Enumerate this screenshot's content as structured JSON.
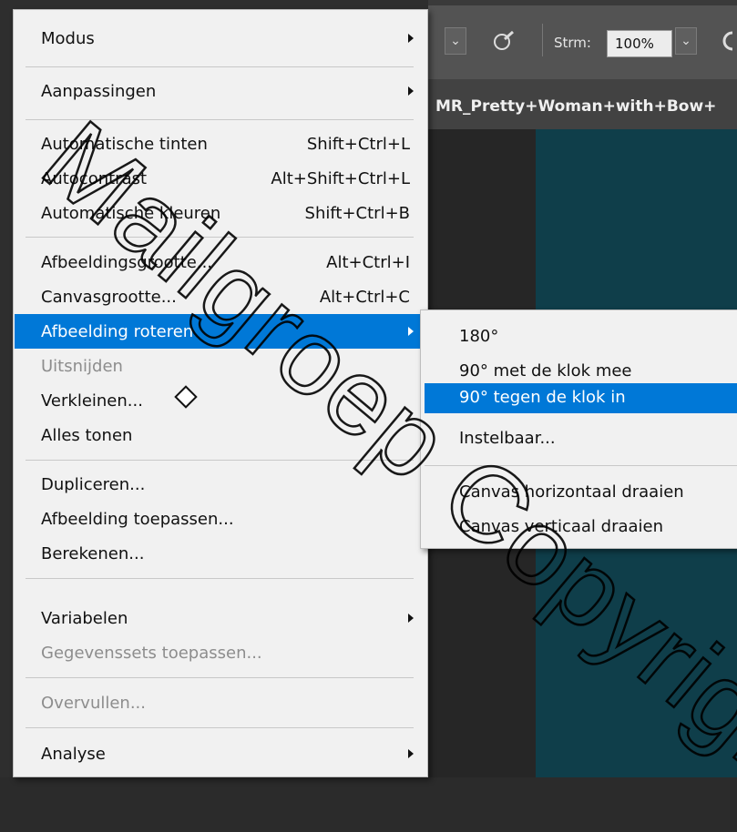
{
  "toolbar": {
    "dropdown_glyph": "⌄",
    "airbrush_icon": "airbrush-icon",
    "flow_label": "Strm:",
    "flow_value": "100%",
    "pressure_icon": "pressure-icon"
  },
  "document": {
    "tab_title": "MR_Pretty+Woman+with+Bow+"
  },
  "menu": {
    "items": [
      {
        "label": "Modus",
        "submenu": true
      },
      {
        "label": "Aanpassingen",
        "submenu": true
      },
      {
        "label": "Automatische tinten",
        "shortcut": "Shift+Ctrl+L"
      },
      {
        "label": "Autocontrast",
        "shortcut": "Alt+Shift+Ctrl+L"
      },
      {
        "label": "Automatische kleuren",
        "shortcut": "Shift+Ctrl+B"
      },
      {
        "label": "Afbeeldingsgrootte...",
        "shortcut": "Alt+Ctrl+I"
      },
      {
        "label": "Canvasgrootte...",
        "shortcut": "Alt+Ctrl+C"
      },
      {
        "label": "Afbeelding roteren",
        "submenu": true,
        "highlighted": true
      },
      {
        "label": "Uitsnijden",
        "disabled": true
      },
      {
        "label": "Verkleinen..."
      },
      {
        "label": "Alles tonen"
      },
      {
        "label": "Dupliceren..."
      },
      {
        "label": "Afbeelding toepassen..."
      },
      {
        "label": "Berekenen..."
      },
      {
        "label": "Variabelen",
        "submenu": true
      },
      {
        "label": "Gegevenssets toepassen...",
        "disabled": true
      },
      {
        "label": "Overvullen...",
        "disabled": true
      },
      {
        "label": "Analyse",
        "submenu": true
      }
    ]
  },
  "submenu": {
    "items": [
      {
        "label": "180°"
      },
      {
        "label": "90° met de klok mee"
      },
      {
        "label": "90° tegen de klok in",
        "highlighted": true
      },
      {
        "label": "Instelbaar..."
      },
      {
        "label": "Canvas horizontaal draaien"
      },
      {
        "label": "Canvas verticaal draaien"
      }
    ]
  },
  "colors": {
    "highlight": "#0078d7",
    "menu_bg": "#f1f1f1",
    "canvas": "#0f3e4a"
  }
}
